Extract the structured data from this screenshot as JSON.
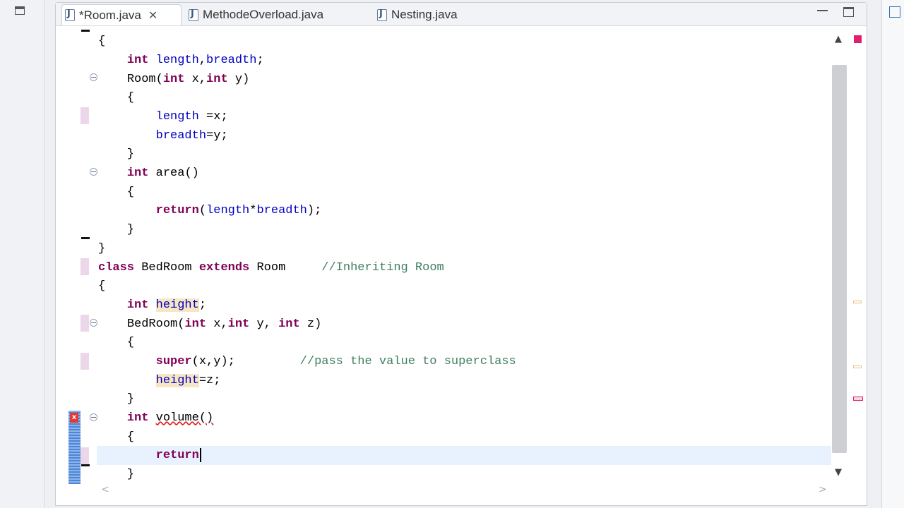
{
  "tabs": [
    {
      "label": "*Room.java",
      "active": true,
      "closable": true
    },
    {
      "label": "MethodeOverload.java",
      "active": false
    },
    {
      "label": "Nesting.java",
      "active": false
    }
  ],
  "code_lines": [
    "{",
    "    int length,breadth;",
    "    Room(int x,int y)",
    "    {",
    "        length =x;",
    "        breadth=y;",
    "    }",
    "    int area()",
    "    {",
    "        return(length*breadth);",
    "    }",
    "}",
    "class BedRoom extends Room     //Inheriting Room",
    "{",
    "    int height;",
    "    BedRoom(int x,int y, int z)",
    "    {",
    "        super(x,y);         //pass the value to superclass",
    "        height=z;",
    "    }",
    "    int volume()",
    "    {",
    "        return",
    "    }"
  ],
  "tokens": {
    "int": "int",
    "length": "length",
    "breadth": "breadth",
    "room": "Room",
    "x": "x",
    "y": "y",
    "z": "z",
    "area": "area",
    "return": "return",
    "class": "class",
    "bedroom": "BedRoom",
    "extends": "extends",
    "comment_inherit": "//Inheriting Room",
    "height": "height",
    "super": "super",
    "comment_pass": "//pass the value to superclass",
    "volume": "volume"
  },
  "colors": {
    "keyword": "#7f0055",
    "field": "#0000c0",
    "comment": "#3f7f5f",
    "current_line": "#e8f2fe",
    "occurrence_highlight": "#f7e6c4",
    "error": "#e02020"
  },
  "icons": {
    "java_file": "J",
    "tab_close": "✕",
    "fold_minus": "−",
    "scroll_up": "▲",
    "scroll_down": "▼",
    "scroll_left": "<",
    "scroll_right": ">",
    "error": "x"
  }
}
